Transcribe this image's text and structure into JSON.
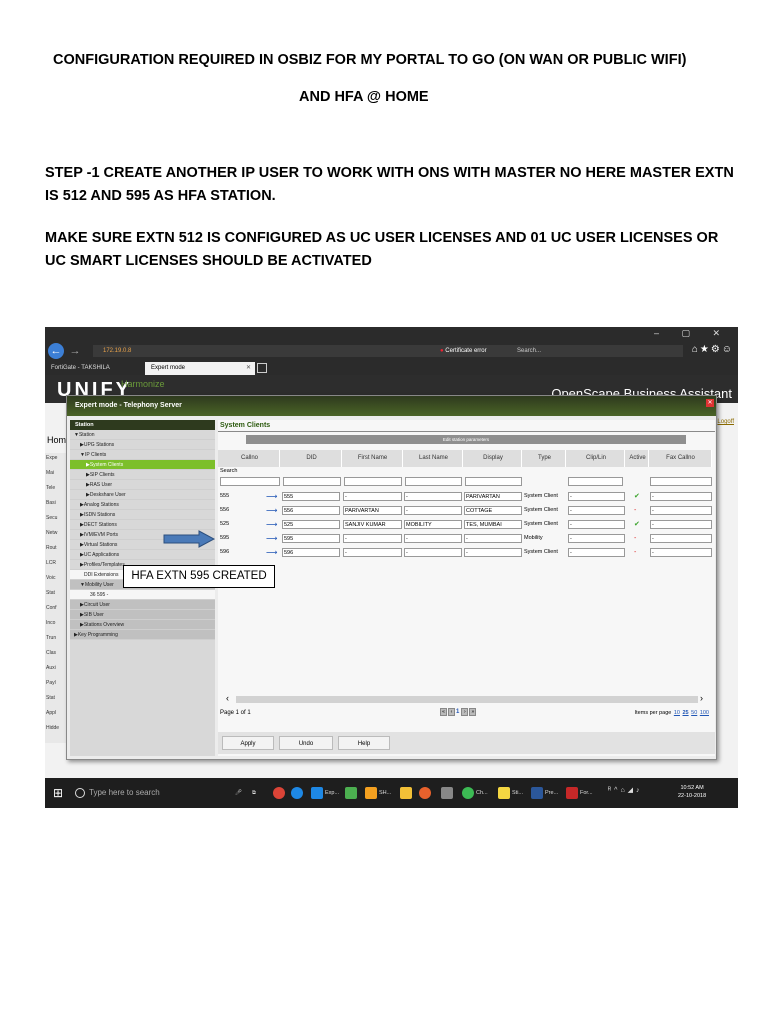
{
  "document": {
    "heading_line1": "CONFIGURATION REQUIRED IN OSBIZ FOR MY PORTAL TO GO (ON WAN OR PUBLIC WIFI)",
    "heading_line2": "AND HFA @ HOME",
    "step1": "STEP -1  CREATE ANOTHER IP USER TO WORK WITH ONS WITH MASTER NO HERE MASTER EXTN IS 512 AND 595 AS  HFA STATION.",
    "note": "MAKE SURE EXTN 512 IS CONFIGURED AS UC USER LICENSES AND 01 UC USER LICENSES OR UC SMART LICENSES SHOULD BE ACTIVATED"
  },
  "browser": {
    "address": "172.19.0.8",
    "cert_error": "Certificate error",
    "search_placeholder": "Search...",
    "tab1": "FortiGate - TAKSHILA",
    "tab2": "Expert mode"
  },
  "app": {
    "logo": "UNIFY",
    "subtitle": "Harmonize",
    "product": "OpenScape Business Assistant",
    "home": "Hom",
    "logoff": "Logoff"
  },
  "bg_sidebar": [
    "Expe",
    "Mai",
    "Tele",
    "Basi",
    "Secu",
    "Netw",
    "Rout",
    "LCR",
    "Voic",
    "Stat",
    "Conf",
    "Inco",
    "Trun",
    "Clas",
    "Auxi",
    "Payl",
    "Stat",
    "Appl",
    "Hidde"
  ],
  "dialog": {
    "title": "Expert mode - Telephony Server",
    "tree_header": "Station",
    "tree": [
      {
        "label": "▼Station",
        "indent": 4,
        "style": ""
      },
      {
        "label": "▶UPG Stations",
        "indent": 10,
        "style": ""
      },
      {
        "label": "▼IP Clients",
        "indent": 10,
        "style": ""
      },
      {
        "label": "▶System Clients",
        "indent": 16,
        "style": "sel"
      },
      {
        "label": "▶SIP Clients",
        "indent": 16,
        "style": ""
      },
      {
        "label": "▶RAS User",
        "indent": 16,
        "style": ""
      },
      {
        "label": "▶Deskshare User",
        "indent": 16,
        "style": ""
      },
      {
        "label": "▶Analog Stations",
        "indent": 10,
        "style": ""
      },
      {
        "label": "▶ISDN Stations",
        "indent": 10,
        "style": ""
      },
      {
        "label": "▶DECT Stations",
        "indent": 10,
        "style": ""
      },
      {
        "label": "▶IVM/EVM Ports",
        "indent": 10,
        "style": ""
      },
      {
        "label": "▶Virtual Stations",
        "indent": 10,
        "style": ""
      },
      {
        "label": "▶UC Applications",
        "indent": 10,
        "style": ""
      },
      {
        "label": "▶Profiles/Templates",
        "indent": 10,
        "style": ""
      },
      {
        "label": "DDI Extensions",
        "indent": 14,
        "style": "white"
      },
      {
        "label": "▼Mobility User",
        "indent": 10,
        "style": "grey"
      },
      {
        "label": "36 595 -",
        "indent": 20,
        "style": "white"
      },
      {
        "label": "▶Circuit User",
        "indent": 10,
        "style": "grey"
      },
      {
        "label": "▶SIB User",
        "indent": 10,
        "style": "grey"
      },
      {
        "label": "▶Stations Overview",
        "indent": 10,
        "style": "grey"
      },
      {
        "label": "▶Key Programming",
        "indent": 4,
        "style": "grey"
      }
    ],
    "section_title": "System Clients",
    "edit_bar": "Edit station parameters",
    "columns": [
      "Callno",
      "DID",
      "First Name",
      "Last Name",
      "Display",
      "Type",
      "Clip/Lin",
      "Active",
      "Fax Callno"
    ],
    "search_label": "Search",
    "rows": [
      {
        "callno": "555",
        "did": "555",
        "first": "-",
        "last": "-",
        "display": "PARIVARTAN",
        "type": "System Client",
        "clip": "-",
        "active": "✔",
        "active_ok": true,
        "fax": "-"
      },
      {
        "callno": "556",
        "did": "556",
        "first": "PARIVARTAN",
        "last": "-",
        "display": "COTTAGE",
        "type": "System Client",
        "clip": "-",
        "active": "-",
        "active_ok": false,
        "fax": "-"
      },
      {
        "callno": "525",
        "did": "525",
        "first": "SANJIV KUMAR",
        "last": "MOBILITY",
        "display": "TES, MUMBAI",
        "type": "System Client",
        "clip": "-",
        "active": "✔",
        "active_ok": true,
        "fax": "-"
      },
      {
        "callno": "595",
        "did": "595",
        "first": "-",
        "last": "-",
        "display": "-",
        "type": "Mobility",
        "clip": "-",
        "active": "-",
        "active_ok": false,
        "fax": "-"
      },
      {
        "callno": "596",
        "did": "596",
        "first": "-",
        "last": "-",
        "display": "-",
        "type": "System Client",
        "clip": "-",
        "active": "-",
        "active_ok": false,
        "fax": "-"
      }
    ],
    "page_info": "Page 1 of 1",
    "page_current": "1",
    "items_per_page_label": "Items per page",
    "items_per_page": [
      "10",
      "25",
      "50",
      "100"
    ],
    "buttons": [
      "Apply",
      "Undo",
      "Help"
    ]
  },
  "callout": "HFA EXTN 595 CREATED",
  "taskbar": {
    "search": "Type here to search",
    "apps": [
      "Exp...",
      "SH...",
      "Ch...",
      "Sti...",
      "Pre...",
      "For..."
    ],
    "time": "10:52 AM",
    "date": "22-10-2018"
  },
  "colors": {
    "accent_green": "#7cbf2a",
    "dialog_title": "#3a4c1e",
    "arrow_blue": "#1f55b5"
  }
}
